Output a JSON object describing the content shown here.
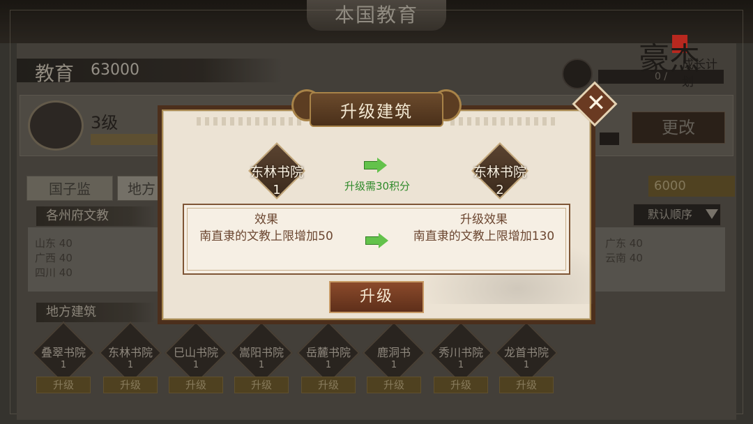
{
  "background": {
    "screen_title": "本国教育",
    "education_label": "教育",
    "education_value": "63000",
    "law_level": "3级",
    "change_button": "更改",
    "tabs": [
      "国子监",
      "地方"
    ],
    "score_value": "6000",
    "province_header": "各州府文教",
    "sort_button": "默认顺序",
    "provinces": [
      {
        "name": "山东",
        "value": "40"
      },
      {
        "name": "广西",
        "value": "40"
      },
      {
        "name": "四川",
        "value": "40"
      },
      {
        "name": "广东",
        "value": "40"
      },
      {
        "name": "云南",
        "value": "40"
      }
    ],
    "buildings_header": "地方建筑",
    "buildings": [
      {
        "name": "叠翠书院",
        "level": "1",
        "button": "升级"
      },
      {
        "name": "东林书院",
        "level": "1",
        "button": "升级"
      },
      {
        "name": "巳山书院",
        "level": "1",
        "button": "升级"
      },
      {
        "name": "嵩阳书院",
        "level": "1",
        "button": "升级"
      },
      {
        "name": "岳麓书院",
        "level": "1",
        "button": "升级"
      },
      {
        "name": "鹿洞书",
        "level": "1",
        "button": "升级"
      },
      {
        "name": "秀川书院",
        "level": "1",
        "button": "升级"
      },
      {
        "name": "龙首书院",
        "level": "1",
        "button": "升级"
      }
    ],
    "progress_text": "0 /"
  },
  "logo": {
    "main": "豪杰",
    "sub": "成长计划"
  },
  "modal": {
    "title": "升级建筑",
    "current": {
      "name": "东林书院",
      "level": "1"
    },
    "next": {
      "name": "东林书院",
      "level": "2"
    },
    "cost_text": "升级需30积分",
    "effect_title": "效果",
    "effect_text": "南直隶的文教上限增加50",
    "upgrade_effect_title": "升级效果",
    "upgrade_effect_text": "南直隶的文教上限增加130",
    "upgrade_button": "升级",
    "close_icon": "close-icon"
  },
  "colors": {
    "modal_bg": "#ece3d4",
    "modal_border": "#4c2f1c",
    "arrow_green": "#63c24b",
    "cost_green": "#2f8a2a",
    "effect_text": "#6b4630"
  }
}
